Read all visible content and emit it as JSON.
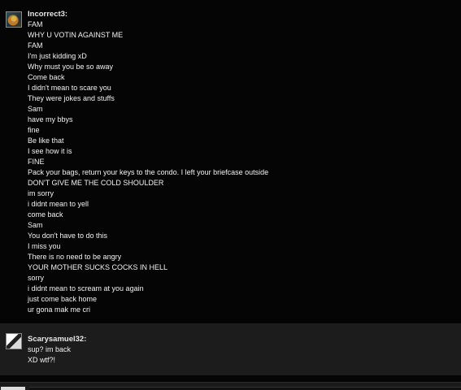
{
  "messages": [
    {
      "author": "Incorrect3:",
      "lines": [
        "FAM",
        "WHY U VOTIN AGAINST ME",
        "FAM",
        "I'm just kidding xD",
        "Why must you be so away",
        "Come back",
        "I didn't mean to scare you",
        "They were jokes and stuffs",
        "Sam",
        "have my bbys",
        "fine",
        "Be like that",
        "I see how it is",
        "FINE",
        "Pack your bags, return your keys to the condo. I left your briefcase outside",
        "DON'T GIVE ME THE COLD SHOULDER",
        "im sorry",
        "i didnt mean to yell",
        "come back",
        "Sam",
        "You don't have to do this",
        "I miss you",
        "There is no need to be angry",
        "YOUR MOTHER SUCKS COCKS IN HELL",
        "sorry",
        "i didnt mean to scream at you again",
        "just come back home",
        "ur gona mak me cri"
      ]
    },
    {
      "author": "Scarysamuel32:",
      "lines": [
        "sup? im back",
        "XD wtf?!"
      ]
    }
  ]
}
